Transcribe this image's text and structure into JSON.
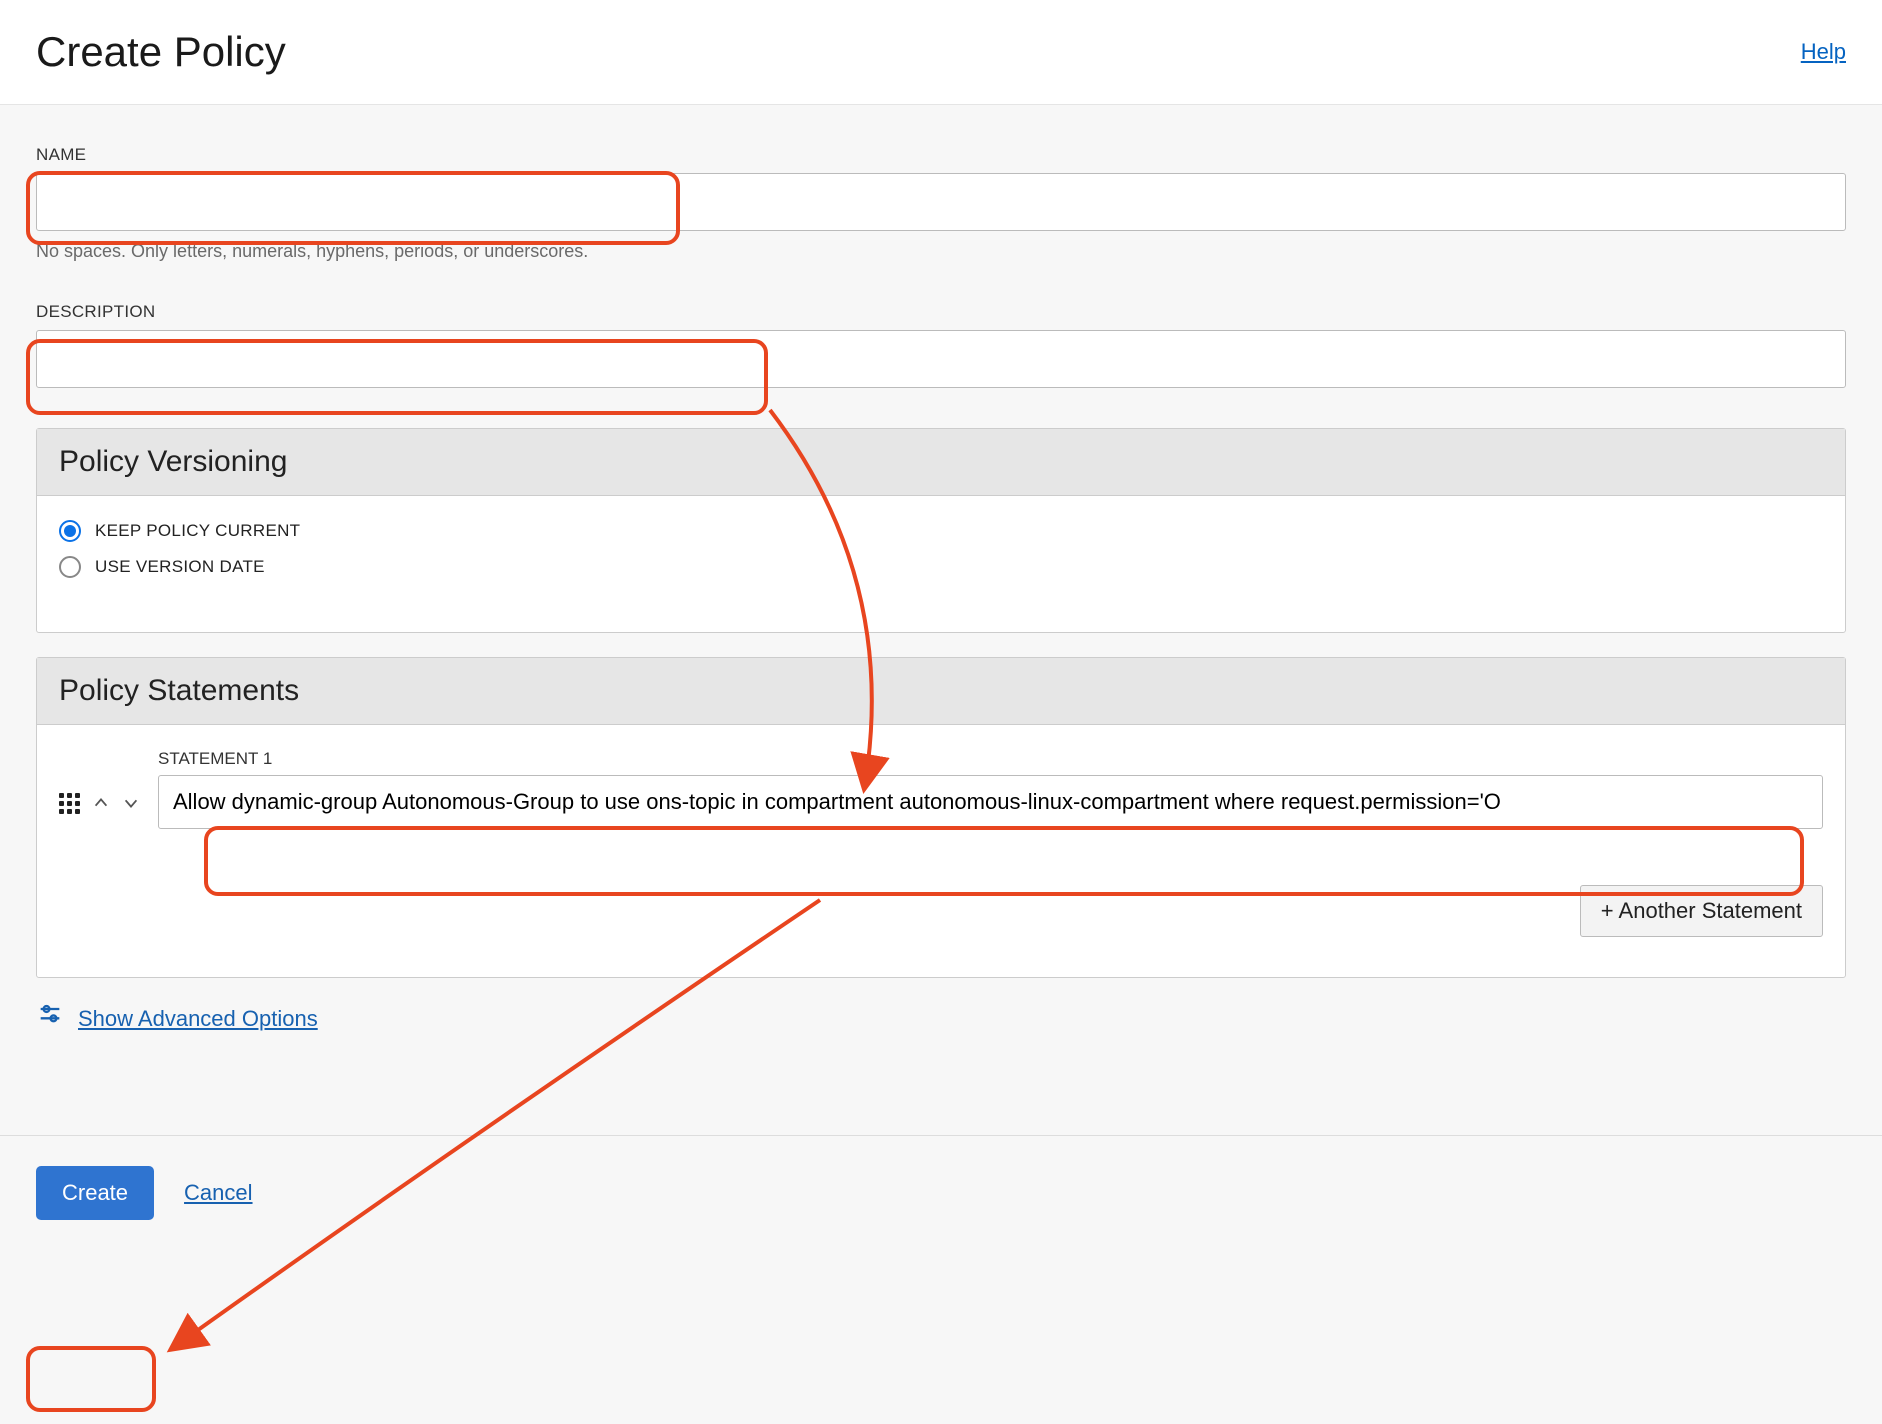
{
  "header": {
    "title": "Create Policy",
    "help": "Help"
  },
  "fields": {
    "name_label": "NAME",
    "name_value": "",
    "name_helper": "No spaces. Only letters, numerals, hyphens, periods, or underscores.",
    "description_label": "DESCRIPTION",
    "description_value": ""
  },
  "versioning": {
    "panel_title": "Policy Versioning",
    "keep_current": {
      "label": "KEEP POLICY CURRENT",
      "checked": true
    },
    "use_version_date": {
      "label": "USE VERSION DATE",
      "checked": false
    }
  },
  "statements": {
    "panel_title": "Policy Statements",
    "items": [
      {
        "label": "STATEMENT 1",
        "value": "Allow dynamic-group Autonomous-Group to use ons-topic in compartment autonomous-linux-compartment where request.permission='O"
      }
    ],
    "add_button": "+ Another Statement"
  },
  "advanced": {
    "link": "Show Advanced Options"
  },
  "footer": {
    "create": "Create",
    "cancel": "Cancel"
  },
  "annotations": {
    "highlights": [
      "name-input",
      "description-input",
      "statement-1-input",
      "create-button"
    ],
    "arrows": [
      {
        "from": "description-input",
        "to": "statement-1-input"
      },
      {
        "from": "statement-1-input",
        "to": "create-button"
      }
    ]
  }
}
